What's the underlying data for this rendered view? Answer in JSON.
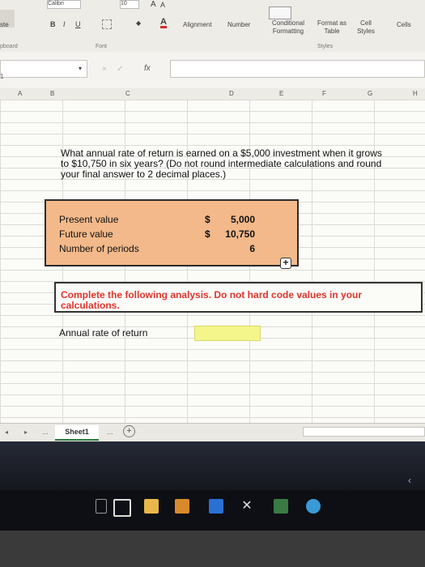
{
  "ribbon": {
    "font_name": "Calibri",
    "font_size": "10",
    "paste_label": "ste",
    "bold_btn": "B",
    "italic_btn": "I",
    "underline_btn": "U",
    "grow_font": "A",
    "shrink_font": "A",
    "font_color_btn": "A",
    "alignment_label": "Alignment",
    "number_label": "Number",
    "conditional_formatting_label": "Conditional Formatting",
    "format_as_table_label": "Format as Table",
    "cell_styles_label": "Cell Styles",
    "cells_label": "Cells",
    "clipboard_group": "pboard",
    "font_group": "Font",
    "styles_group": "Styles"
  },
  "formula_bar": {
    "fx": "fx",
    "cancel": "×",
    "enter": "✓"
  },
  "row_indicator": "1",
  "columns": [
    "A",
    "B",
    "C",
    "D",
    "E",
    "F",
    "G",
    "H"
  ],
  "sheet": {
    "question": "What annual rate of return is earned on a $5,000 investment when it grows to $10,750 in six years? (Do not round intermediate calculations and round your final answer to 2 decimal places.)",
    "inputs": [
      {
        "label": "Present value",
        "currency": "$",
        "value": "5,000"
      },
      {
        "label": "Future value",
        "currency": "$",
        "value": "10,750"
      },
      {
        "label": "Number of periods",
        "currency": "",
        "value": "6"
      }
    ],
    "instruction": "Complete the following analysis. Do not hard code values in your calculations.",
    "result_label": "Annual rate of return",
    "result_value": ""
  },
  "tabs": {
    "sheet_name": "Sheet1",
    "more": "...",
    "add": "+"
  },
  "colors": {
    "input_fill": "#f3b98a",
    "instruction_text": "#e0352c",
    "answer_fill": "#f4f58a"
  }
}
